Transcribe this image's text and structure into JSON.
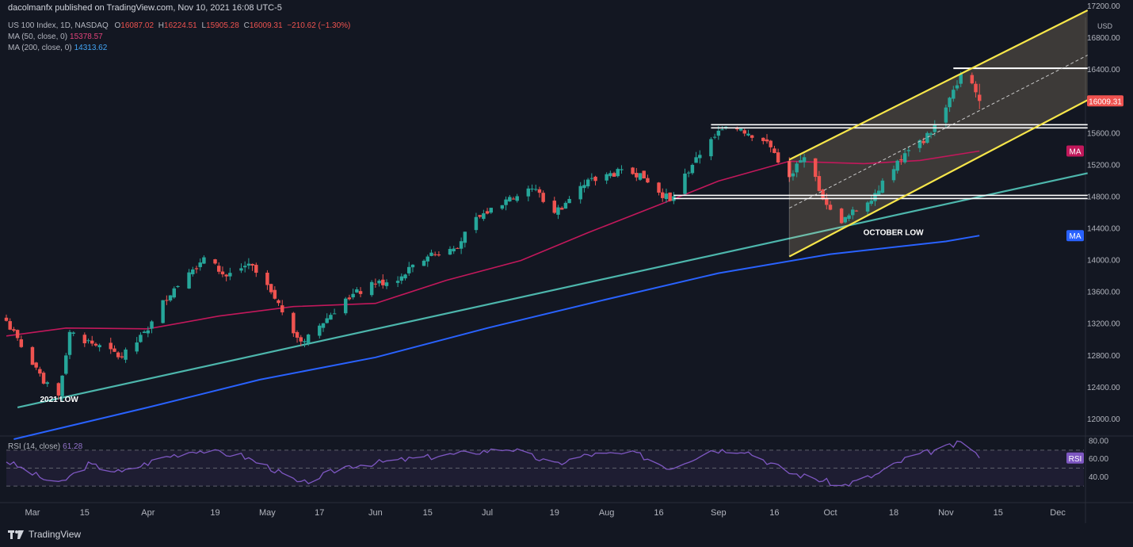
{
  "header": {
    "published": "dacolmanfx published on TradingView.com, Nov 10, 2021 16:08 UTC-5"
  },
  "legend": {
    "main_name": "US 100 Index, 1D, NASDAQ",
    "o_label": "O",
    "o_value": "16087.02",
    "h_label": "H",
    "h_value": "16224.51",
    "l_label": "L",
    "l_value": "15905.28",
    "c_label": "C",
    "c_value": "16009.31",
    "change": "−210.62 (−1.30%)",
    "ma50_label": "MA (50, close, 0)",
    "ma50_value": "15378.57",
    "ma200_label": "MA (200, close, 0)",
    "ma200_value": "14313.62",
    "rsi_label": "RSI (14, close)",
    "rsi_value": "61.28"
  },
  "colors": {
    "background": "#131722",
    "up": "#26a69a",
    "down": "#ef5350",
    "ma50": "#c2185b",
    "ma200": "#2962ff",
    "channel": "#f7e64a",
    "trendline": "#4db6ac",
    "rsi_line": "#7e57c2",
    "text": "#b2b5be",
    "price_badge": "#ef5350"
  },
  "brand": {
    "name": "TradingView",
    "logo_icon": "tradingview-logo-icon"
  },
  "chart_data": {
    "type": "candlestick",
    "x_axis": {
      "ticks": [
        {
          "label": "Mar",
          "date": "2021-03-01"
        },
        {
          "label": "15",
          "date": "2021-03-15"
        },
        {
          "label": "Apr",
          "date": "2021-04-01"
        },
        {
          "label": "19",
          "date": "2021-04-19"
        },
        {
          "label": "May",
          "date": "2021-05-03"
        },
        {
          "label": "17",
          "date": "2021-05-17"
        },
        {
          "label": "Jun",
          "date": "2021-06-01"
        },
        {
          "label": "15",
          "date": "2021-06-15"
        },
        {
          "label": "Jul",
          "date": "2021-07-01"
        },
        {
          "label": "19",
          "date": "2021-07-19"
        },
        {
          "label": "Aug",
          "date": "2021-08-02"
        },
        {
          "label": "16",
          "date": "2021-08-16"
        },
        {
          "label": "Sep",
          "date": "2021-09-01"
        },
        {
          "label": "16",
          "date": "2021-09-16"
        },
        {
          "label": "Oct",
          "date": "2021-10-01"
        },
        {
          "label": "18",
          "date": "2021-10-18"
        },
        {
          "label": "Nov",
          "date": "2021-11-01"
        },
        {
          "label": "15",
          "date": "2021-11-15"
        },
        {
          "label": "Dec",
          "date": "2021-12-01"
        }
      ],
      "start_date": "2021-02-22",
      "end_date": "2021-12-08"
    },
    "y_axis": {
      "currency": "USD",
      "range": [
        11800,
        17200
      ],
      "ticks": [
        "12000.00",
        "12400.00",
        "12800.00",
        "13200.00",
        "13600.00",
        "14000.00",
        "14400.00",
        "14800.00",
        "15200.00",
        "15600.00",
        "16000.00",
        "16400.00",
        "16800.00",
        "17200.00"
      ]
    },
    "last_price": "16009.31",
    "ma_badge": "MA",
    "rsi_badge": "RSI",
    "rsi_axis": {
      "range": [
        15,
        85
      ],
      "ticks": [
        "40.00",
        "60.00",
        "80.00"
      ],
      "levels": [
        70,
        50,
        30
      ]
    },
    "closes": [
      {
        "date": "2021-02-22",
        "close": 13240
      },
      {
        "date": "2021-02-26",
        "close": 12910
      },
      {
        "date": "2021-03-04",
        "close": 12450
      },
      {
        "date": "2021-03-08",
        "close": 12300
      },
      {
        "date": "2021-03-11",
        "close": 13100
      },
      {
        "date": "2021-03-18",
        "close": 12930
      },
      {
        "date": "2021-03-25",
        "close": 12780
      },
      {
        "date": "2021-04-01",
        "close": 13120
      },
      {
        "date": "2021-04-05",
        "close": 13500
      },
      {
        "date": "2021-04-12",
        "close": 13850
      },
      {
        "date": "2021-04-16",
        "close": 14040
      },
      {
        "date": "2021-04-22",
        "close": 13800
      },
      {
        "date": "2021-04-28",
        "close": 13960
      },
      {
        "date": "2021-05-04",
        "close": 13600
      },
      {
        "date": "2021-05-12",
        "close": 12980
      },
      {
        "date": "2021-05-17",
        "close": 13180
      },
      {
        "date": "2021-05-24",
        "close": 13520
      },
      {
        "date": "2021-06-01",
        "close": 13700
      },
      {
        "date": "2021-06-08",
        "close": 13800
      },
      {
        "date": "2021-06-15",
        "close": 14050
      },
      {
        "date": "2021-06-22",
        "close": 14150
      },
      {
        "date": "2021-06-29",
        "close": 14550
      },
      {
        "date": "2021-07-07",
        "close": 14800
      },
      {
        "date": "2021-07-14",
        "close": 14900
      },
      {
        "date": "2021-07-19",
        "close": 14600
      },
      {
        "date": "2021-07-27",
        "close": 14950
      },
      {
        "date": "2021-08-03",
        "close": 15100
      },
      {
        "date": "2021-08-11",
        "close": 15100
      },
      {
        "date": "2021-08-19",
        "close": 14750
      },
      {
        "date": "2021-08-26",
        "close": 15300
      },
      {
        "date": "2021-09-02",
        "close": 15650
      },
      {
        "date": "2021-09-07",
        "close": 15660
      },
      {
        "date": "2021-09-14",
        "close": 15500
      },
      {
        "date": "2021-09-20",
        "close": 15050
      },
      {
        "date": "2021-09-24",
        "close": 15300
      },
      {
        "date": "2021-09-30",
        "close": 14700
      },
      {
        "date": "2021-10-04",
        "close": 14470
      },
      {
        "date": "2021-10-13",
        "close": 14850
      },
      {
        "date": "2021-10-18",
        "close": 15150
      },
      {
        "date": "2021-10-22",
        "close": 15390
      },
      {
        "date": "2021-10-28",
        "close": 15600
      },
      {
        "date": "2021-11-03",
        "close": 16150
      },
      {
        "date": "2021-11-05",
        "close": 16350
      },
      {
        "date": "2021-11-08",
        "close": 16230
      },
      {
        "date": "2021-11-10",
        "close": 16009
      }
    ],
    "ma50": [
      {
        "date": "2021-02-22",
        "value": 13050
      },
      {
        "date": "2021-03-10",
        "value": 13150
      },
      {
        "date": "2021-04-01",
        "value": 13140
      },
      {
        "date": "2021-04-20",
        "value": 13300
      },
      {
        "date": "2021-05-10",
        "value": 13420
      },
      {
        "date": "2021-06-01",
        "value": 13460
      },
      {
        "date": "2021-06-20",
        "value": 13750
      },
      {
        "date": "2021-07-10",
        "value": 14000
      },
      {
        "date": "2021-07-28",
        "value": 14350
      },
      {
        "date": "2021-08-16",
        "value": 14700
      },
      {
        "date": "2021-09-01",
        "value": 15000
      },
      {
        "date": "2021-09-20",
        "value": 15250
      },
      {
        "date": "2021-10-10",
        "value": 15220
      },
      {
        "date": "2021-10-25",
        "value": 15260
      },
      {
        "date": "2021-11-10",
        "value": 15378
      }
    ],
    "ma200": [
      {
        "date": "2021-02-24",
        "value": 11750
      },
      {
        "date": "2021-04-01",
        "value": 12150
      },
      {
        "date": "2021-05-01",
        "value": 12500
      },
      {
        "date": "2021-06-01",
        "value": 12780
      },
      {
        "date": "2021-07-01",
        "value": 13150
      },
      {
        "date": "2021-08-01",
        "value": 13500
      },
      {
        "date": "2021-09-01",
        "value": 13840
      },
      {
        "date": "2021-10-01",
        "value": 14080
      },
      {
        "date": "2021-11-01",
        "value": 14240
      },
      {
        "date": "2021-11-10",
        "value": 14313
      }
    ],
    "rsi": [
      {
        "date": "2021-02-22",
        "value": 58
      },
      {
        "date": "2021-03-04",
        "value": 38
      },
      {
        "date": "2021-03-08",
        "value": 32
      },
      {
        "date": "2021-03-16",
        "value": 54
      },
      {
        "date": "2021-03-25",
        "value": 45
      },
      {
        "date": "2021-04-05",
        "value": 62
      },
      {
        "date": "2021-04-14",
        "value": 70
      },
      {
        "date": "2021-04-26",
        "value": 64
      },
      {
        "date": "2021-05-04",
        "value": 50
      },
      {
        "date": "2021-05-12",
        "value": 32
      },
      {
        "date": "2021-05-24",
        "value": 52
      },
      {
        "date": "2021-06-10",
        "value": 60
      },
      {
        "date": "2021-06-28",
        "value": 68
      },
      {
        "date": "2021-07-07",
        "value": 72
      },
      {
        "date": "2021-07-19",
        "value": 54
      },
      {
        "date": "2021-07-28",
        "value": 65
      },
      {
        "date": "2021-08-10",
        "value": 66
      },
      {
        "date": "2021-08-19",
        "value": 50
      },
      {
        "date": "2021-08-30",
        "value": 70
      },
      {
        "date": "2021-09-08",
        "value": 70
      },
      {
        "date": "2021-09-20",
        "value": 45
      },
      {
        "date": "2021-09-30",
        "value": 35
      },
      {
        "date": "2021-10-04",
        "value": 30
      },
      {
        "date": "2021-10-13",
        "value": 42
      },
      {
        "date": "2021-10-22",
        "value": 62
      },
      {
        "date": "2021-11-01",
        "value": 73
      },
      {
        "date": "2021-11-05",
        "value": 78
      },
      {
        "date": "2021-11-08",
        "value": 72
      },
      {
        "date": "2021-11-10",
        "value": 61.28
      }
    ],
    "annotations": {
      "low_2021": {
        "text": "2021 LOW",
        "date": "2021-03-06",
        "price": 12220
      },
      "october_low": {
        "text": "OCTOBER LOW",
        "date": "2021-10-09",
        "price": 14320
      },
      "trendline": {
        "from": {
          "date": "2021-02-25",
          "price": 12150
        },
        "to": {
          "date": "2021-12-09",
          "price": 15100
        }
      },
      "channel_upper": {
        "from": {
          "date": "2021-09-20",
          "price": 15270
        },
        "to": {
          "date": "2021-12-09",
          "price": 17150
        }
      },
      "channel_lower": {
        "from": {
          "date": "2021-09-20",
          "price": 14050
        },
        "to": {
          "date": "2021-12-09",
          "price": 16020
        }
      },
      "channel_mid": {
        "from": {
          "date": "2021-09-20",
          "price": 14660
        },
        "to": {
          "date": "2021-12-09",
          "price": 16585
        }
      },
      "resistance_top": {
        "from": "2021-11-03",
        "to": "2021-12-09",
        "price": 16420
      },
      "resistance_sep": {
        "from": "2021-08-30",
        "to": "2021-12-09",
        "price": 15690
      },
      "support_aug": {
        "from": "2021-08-20",
        "to": "2021-12-09",
        "price": 14800
      }
    }
  }
}
